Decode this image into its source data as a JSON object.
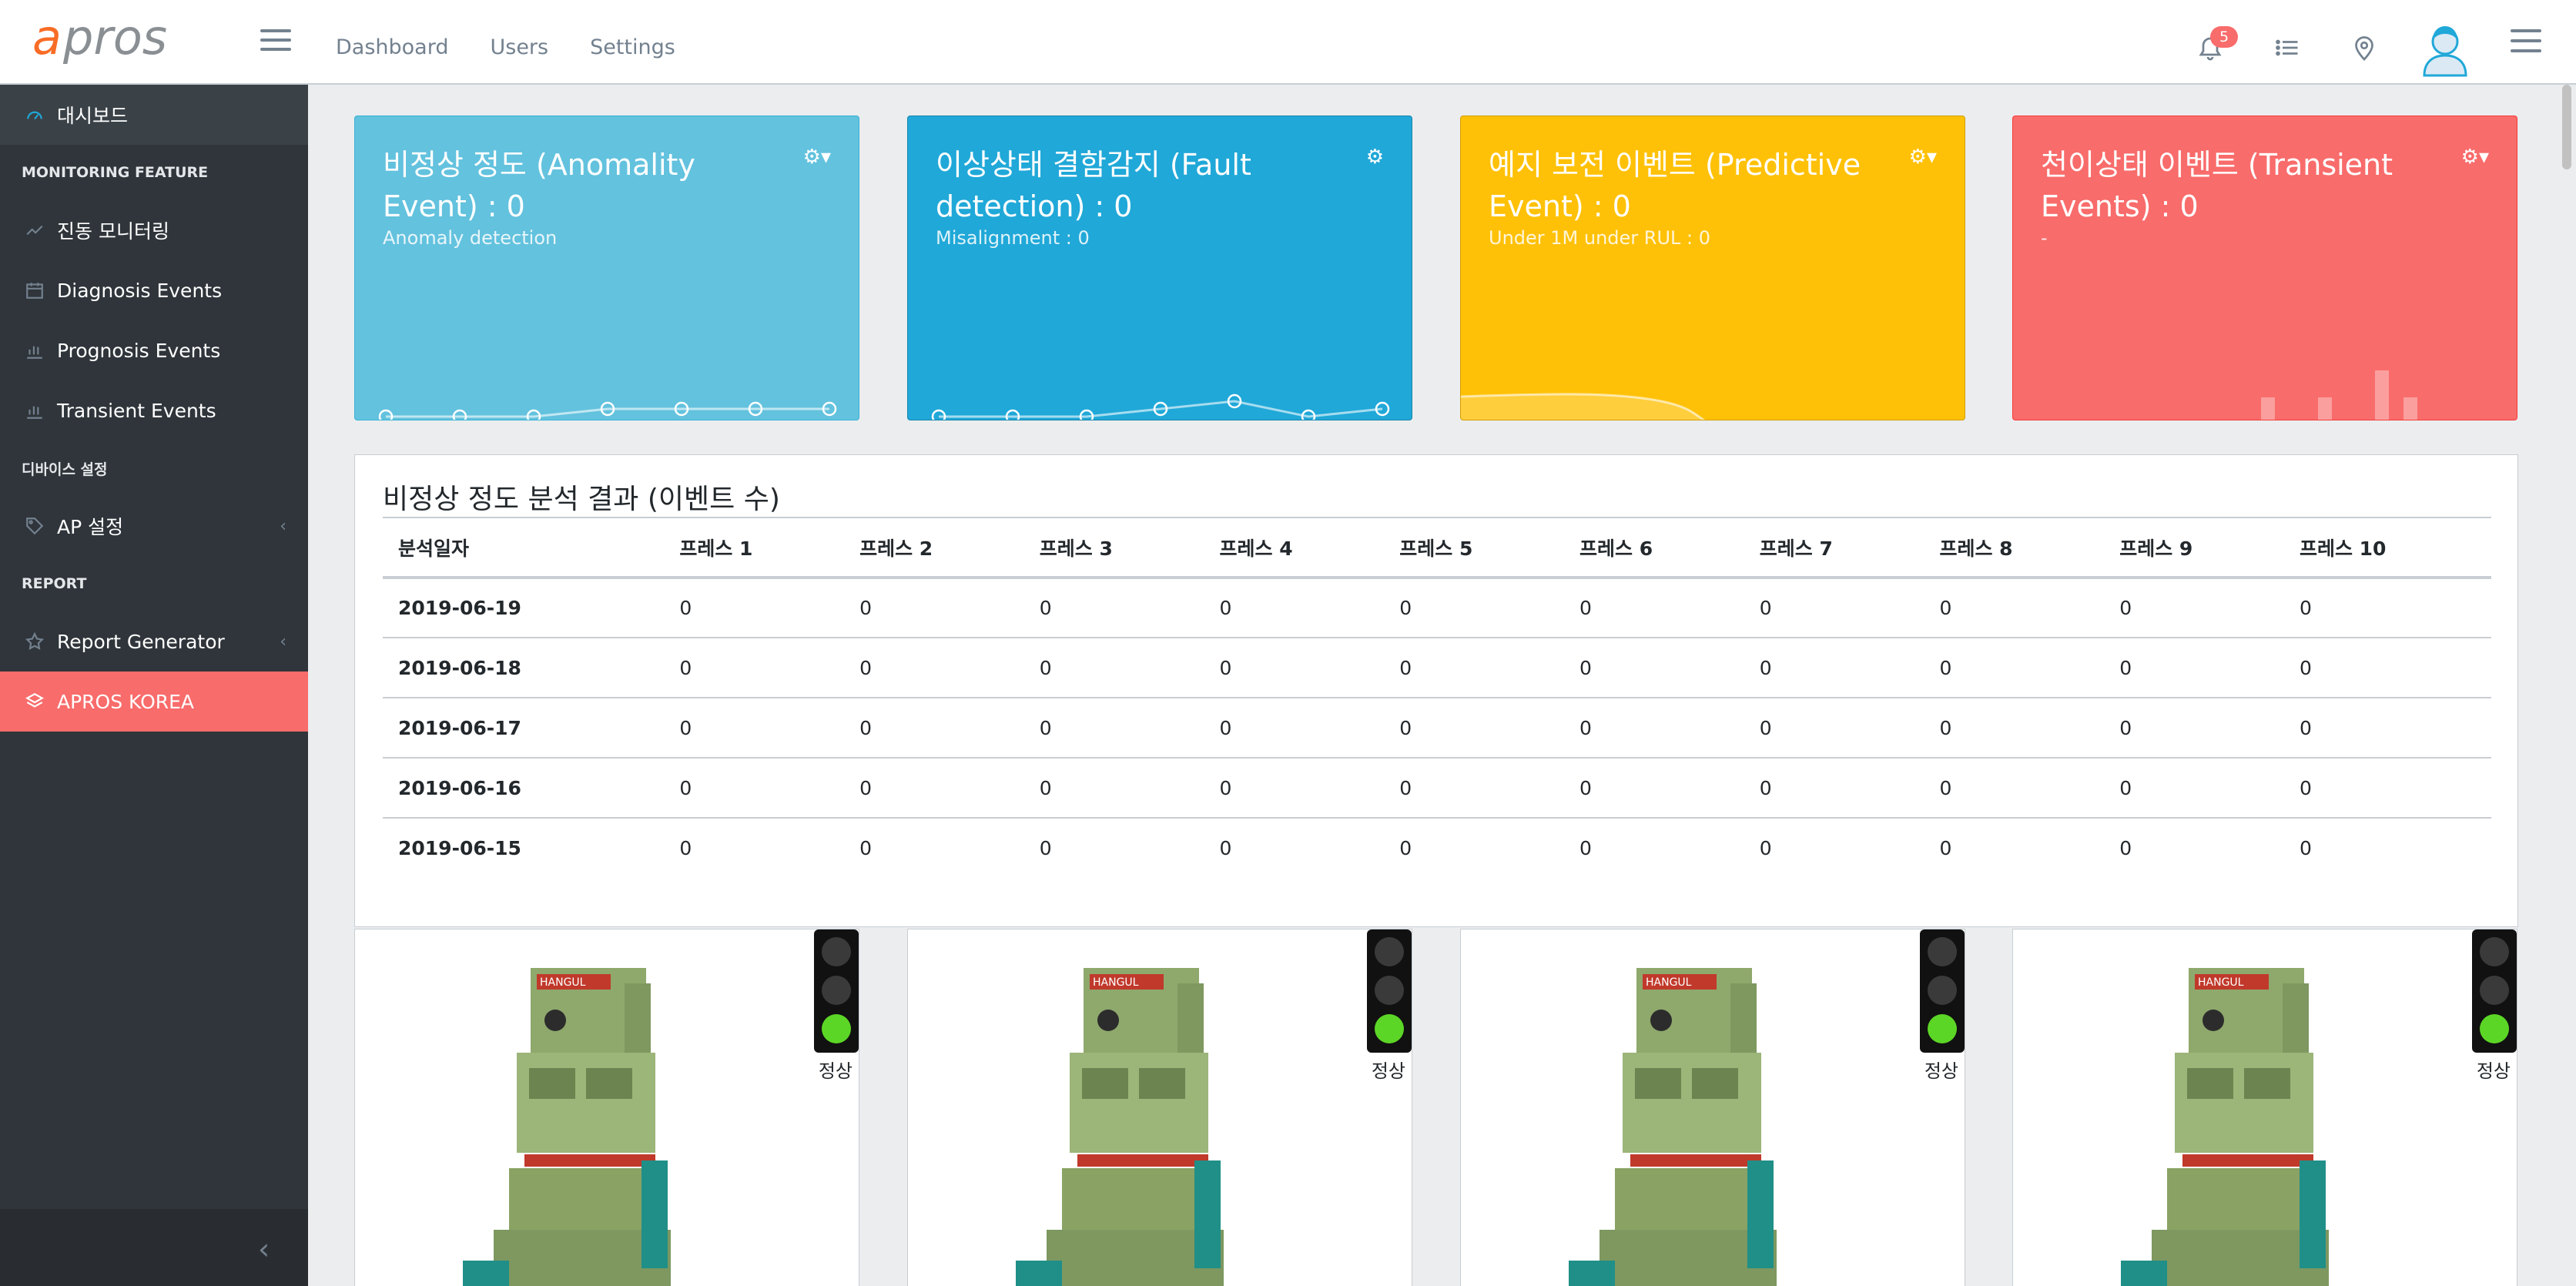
{
  "header": {
    "logo_text": "apros",
    "nav": [
      "Dashboard",
      "Users",
      "Settings"
    ],
    "notification_count": "5",
    "icons": [
      "bell-icon",
      "list-icon",
      "location-pin-icon",
      "avatar-icon",
      "menu-icon"
    ]
  },
  "sidebar": {
    "items": [
      {
        "type": "item",
        "label": "대시보드",
        "icon": "speedometer-icon",
        "active": true
      },
      {
        "type": "title",
        "label": "MONITORING FEATURE"
      },
      {
        "type": "item",
        "label": "진동 모니터링",
        "icon": "trend-icon"
      },
      {
        "type": "item",
        "label": "Diagnosis Events",
        "icon": "calendar-icon"
      },
      {
        "type": "item",
        "label": "Prognosis Events",
        "icon": "bar-chart-icon"
      },
      {
        "type": "item",
        "label": "Transient Events",
        "icon": "bar-chart-icon"
      },
      {
        "type": "title",
        "label": "디바이스 설정"
      },
      {
        "type": "item",
        "label": "AP 설정",
        "icon": "tag-icon",
        "chevron": true
      },
      {
        "type": "title",
        "label": "REPORT"
      },
      {
        "type": "item",
        "label": "Report Generator",
        "icon": "star-icon",
        "chevron": true
      },
      {
        "type": "item",
        "label": "APROS KOREA",
        "icon": "layers-icon",
        "brand": true
      }
    ]
  },
  "cards": [
    {
      "title": "비정상 정도 (Anomality Event) : 0",
      "subtitle": "Anomaly detection",
      "color": "#63c2de",
      "chart": "line",
      "values": [
        0,
        0,
        0,
        1,
        1,
        1,
        1
      ]
    },
    {
      "title": "이상상태 결함감지 (Fault detection) : 0",
      "subtitle": "Misalignment : 0",
      "color": "#20a8d8",
      "chart": "line",
      "values": [
        0,
        0,
        0,
        1,
        2,
        0,
        1
      ]
    },
    {
      "title": "예지 보전 이벤트 (Predictive Event) : 0",
      "subtitle": "Under 1M under RUL : 0",
      "color": "#ffc107",
      "chart": "area"
    },
    {
      "title": "천이상태 이벤트 (Transient Events) : 0",
      "subtitle": "-",
      "color": "#f86c6b",
      "chart": "bar",
      "values": [
        2,
        0,
        0,
        2,
        0,
        4,
        6,
        4,
        6,
        2,
        8,
        6
      ]
    }
  ],
  "table": {
    "title": "비정상 정도 분석 결과 (이벤트 수)",
    "columns": [
      "분석일자",
      "프레스 1",
      "프레스 2",
      "프레스 3",
      "프레스 4",
      "프레스 5",
      "프레스 6",
      "프레스 7",
      "프레스 8",
      "프레스 9",
      "프레스 10"
    ],
    "rows": [
      [
        "2019-06-19",
        "0",
        "0",
        "0",
        "0",
        "0",
        "0",
        "0",
        "0",
        "0",
        "0"
      ],
      [
        "2019-06-18",
        "0",
        "0",
        "0",
        "0",
        "0",
        "0",
        "0",
        "0",
        "0",
        "0"
      ],
      [
        "2019-06-17",
        "0",
        "0",
        "0",
        "0",
        "0",
        "0",
        "0",
        "0",
        "0",
        "0"
      ],
      [
        "2019-06-16",
        "0",
        "0",
        "0",
        "0",
        "0",
        "0",
        "0",
        "0",
        "0",
        "0"
      ],
      [
        "2019-06-15",
        "0",
        "0",
        "0",
        "0",
        "0",
        "0",
        "0",
        "0",
        "0",
        "0"
      ]
    ]
  },
  "machines": [
    {
      "status": "정상"
    },
    {
      "status": "정상"
    },
    {
      "status": "정상"
    },
    {
      "status": "정상"
    }
  ],
  "brand_name": "HANGUL"
}
